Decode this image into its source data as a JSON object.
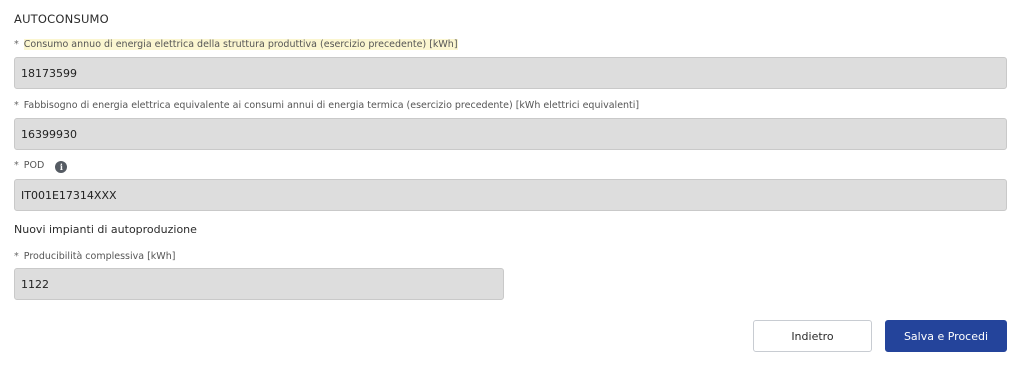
{
  "section": {
    "title": "AUTOCONSUMO"
  },
  "fields": {
    "consumo": {
      "required_mark": "*",
      "label": "Consumo annuo di energia elettrica della struttura produttiva (esercizio precedente) [kWh]",
      "value": "18173599"
    },
    "fabbisogno": {
      "required_mark": "*",
      "label": "Fabbisogno di energia elettrica equivalente ai consumi annui di energia termica (esercizio precedente) [kWh elettrici equivalenti]",
      "value": "16399930"
    },
    "pod": {
      "required_mark": "*",
      "label": "POD",
      "info_icon": "i",
      "value": "IT001E17314XXX"
    },
    "producibilita": {
      "required_mark": "*",
      "label": "Producibilità complessiva [kWh]",
      "value": "1122"
    }
  },
  "subsection": {
    "title": "Nuovi impianti di autoproduzione"
  },
  "buttons": {
    "back_label": "Indietro",
    "save_label": "Salva e Procedi"
  },
  "colors": {
    "primary": "#24449b",
    "input_bg": "#dddddd",
    "label_highlight": "#fbf6d0"
  },
  "icons": {
    "pod_info": "info-icon"
  }
}
